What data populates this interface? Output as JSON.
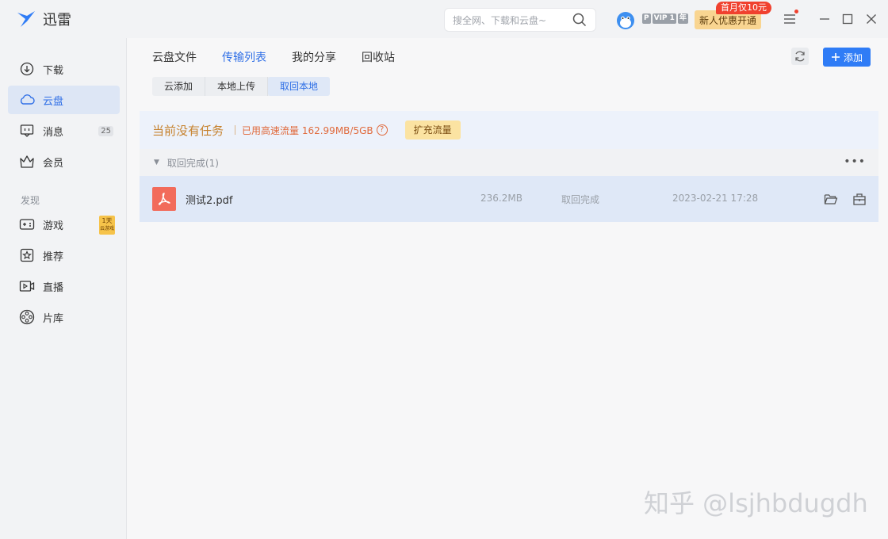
{
  "app": {
    "title": "迅雷"
  },
  "search": {
    "placeholder": "搜全网、下载和云盘~"
  },
  "account": {
    "vip_p": "P",
    "vip_level": "VIP 1",
    "vip_year": "年"
  },
  "promo": {
    "button": "新人优惠开通",
    "tag": "首月仅10元"
  },
  "sidebar": {
    "items": [
      {
        "label": "下载",
        "icon": "download-icon"
      },
      {
        "label": "云盘",
        "icon": "cloud-icon"
      },
      {
        "label": "消息",
        "icon": "message-icon",
        "count": "25"
      },
      {
        "label": "会员",
        "icon": "crown-icon"
      }
    ],
    "section": "发现",
    "discover": [
      {
        "label": "游戏",
        "icon": "gamepad-icon",
        "badge_top": "1天",
        "badge_bottom": "云游戏"
      },
      {
        "label": "推荐",
        "icon": "star-icon"
      },
      {
        "label": "直播",
        "icon": "live-icon"
      },
      {
        "label": "片库",
        "icon": "film-icon"
      }
    ]
  },
  "main": {
    "tabs": [
      "云盘文件",
      "传输列表",
      "我的分享",
      "回收站"
    ],
    "active_tab": "传输列表",
    "subtabs": [
      "云添加",
      "本地上传",
      "取回本地"
    ],
    "active_subtab": "取回本地",
    "add_button": "添加",
    "banner": {
      "title": "当前没有任务",
      "usage": "已用高速流量 162.99MB/5GB",
      "help": "?",
      "expand": "扩充流量"
    },
    "group": {
      "label": "取回完成(1)"
    },
    "files": [
      {
        "name": "测试2.pdf",
        "size": "236.2MB",
        "status": "取回完成",
        "time": "2023-02-21 17:28"
      }
    ]
  },
  "watermark": "知乎 @lsjhbdugdh",
  "colors": {
    "accent": "#2f7cf6",
    "banner_title": "#c6822e",
    "usage": "#e06a3c",
    "pdf": "#f26b5b"
  }
}
